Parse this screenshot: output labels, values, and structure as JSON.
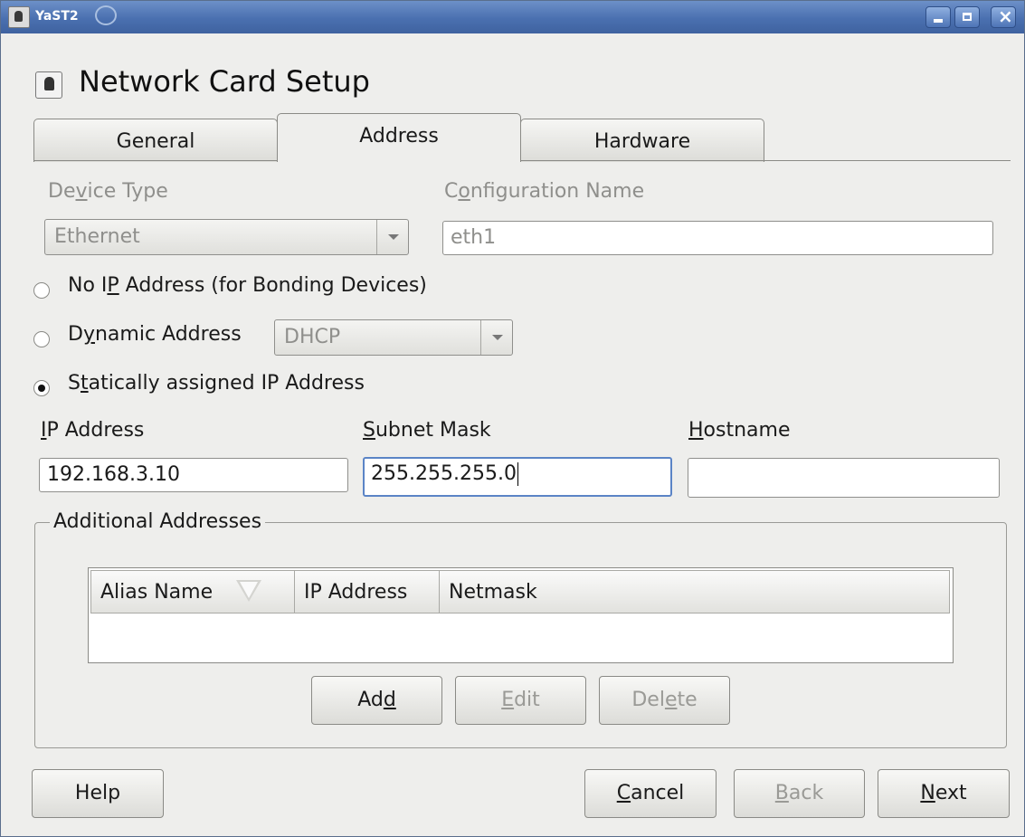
{
  "window": {
    "title": "YaST2"
  },
  "header": {
    "title": "Network Card Setup"
  },
  "tabs": [
    {
      "label": "General"
    },
    {
      "label": "Address"
    },
    {
      "label": "Hardware"
    }
  ],
  "device_type": {
    "label_pre": "De",
    "label_key": "v",
    "label_post": "ice Type",
    "value": "Ethernet"
  },
  "config_name": {
    "label_pre": "C",
    "label_key": "o",
    "label_post": "nfiguration Name",
    "value": "eth1"
  },
  "radios": {
    "no_ip": {
      "pre": "No I",
      "key": "P",
      "post": " Address (for Bonding Devices)",
      "selected": false
    },
    "dynamic": {
      "pre": "D",
      "key": "y",
      "post": "namic Address",
      "selected": false,
      "combo_value": "DHCP"
    },
    "static": {
      "pre": "S",
      "key": "t",
      "post": "atically assigned IP Address",
      "selected": true
    }
  },
  "static_fields": {
    "ip": {
      "key": "I",
      "post": "P Address",
      "value": "192.168.3.10"
    },
    "mask": {
      "key": "S",
      "post": "ubnet Mask",
      "value": "255.255.255.0"
    },
    "host": {
      "key": "H",
      "post": "ostname",
      "value": ""
    }
  },
  "additional": {
    "title": "Additional Addresses",
    "columns": [
      "Alias Name",
      "IP Address",
      "Netmask"
    ],
    "rows": [],
    "buttons": {
      "add": {
        "pre": "Ad",
        "key": "d",
        "post": ""
      },
      "edit": {
        "pre": "",
        "key": "E",
        "post": "dit"
      },
      "delete": {
        "pre": "Del",
        "key": "e",
        "post": "te"
      }
    }
  },
  "footer": {
    "help": "Help",
    "cancel": {
      "key": "C",
      "post": "ancel"
    },
    "back": {
      "key": "B",
      "post": "ack"
    },
    "next": {
      "key": "N",
      "post": "ext"
    }
  }
}
